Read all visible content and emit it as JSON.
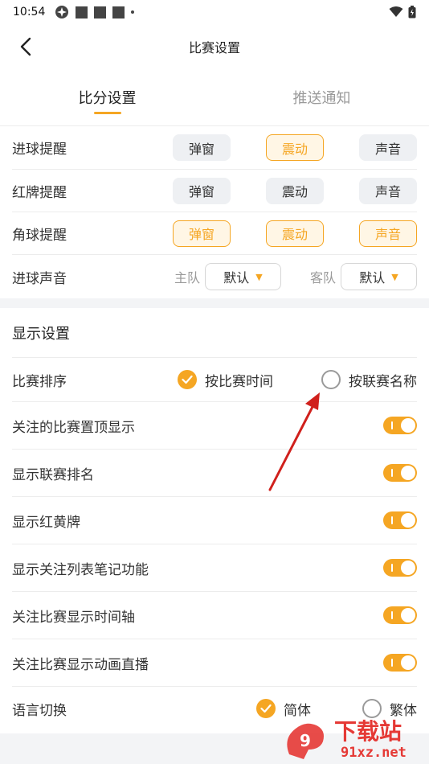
{
  "status_bar": {
    "time": "10:54"
  },
  "header": {
    "title": "比赛设置"
  },
  "tabs": [
    {
      "label": "比分设置",
      "active": true
    },
    {
      "label": "推送通知",
      "active": false
    }
  ],
  "score_settings": {
    "rows": [
      {
        "label": "进球提醒",
        "options": [
          {
            "label": "弹窗",
            "on": false
          },
          {
            "label": "震动",
            "on": true
          },
          {
            "label": "声音",
            "on": false
          }
        ]
      },
      {
        "label": "红牌提醒",
        "options": [
          {
            "label": "弹窗",
            "on": false
          },
          {
            "label": "震动",
            "on": false
          },
          {
            "label": "声音",
            "on": false
          }
        ]
      },
      {
        "label": "角球提醒",
        "options": [
          {
            "label": "弹窗",
            "on": true
          },
          {
            "label": "震动",
            "on": true
          },
          {
            "label": "声音",
            "on": true
          }
        ]
      }
    ],
    "goal_sound": {
      "label": "进球声音",
      "home_label": "主队",
      "home_value": "默认",
      "away_label": "客队",
      "away_value": "默认"
    }
  },
  "display_settings": {
    "title": "显示设置",
    "sort": {
      "label": "比赛排序",
      "option_time": "按比赛时间",
      "option_league": "按联赛名称",
      "selected": "time"
    },
    "toggles": [
      {
        "label": "关注的比赛置顶显示",
        "on": true
      },
      {
        "label": "显示联赛排名",
        "on": true
      },
      {
        "label": "显示红黄牌",
        "on": true
      },
      {
        "label": "显示关注列表笔记功能",
        "on": true
      },
      {
        "label": "关注比赛显示时间轴",
        "on": true
      },
      {
        "label": "关注比赛显示动画直播",
        "on": true
      }
    ],
    "language": {
      "label": "语言切换",
      "option_simplified": "简体",
      "option_traditional": "繁体",
      "selected": "simplified"
    }
  },
  "watermark": {
    "text": "下载站",
    "domain": "91xz.net"
  },
  "colors": {
    "accent": "#f5a623",
    "annotation_arrow": "#d0201c"
  }
}
